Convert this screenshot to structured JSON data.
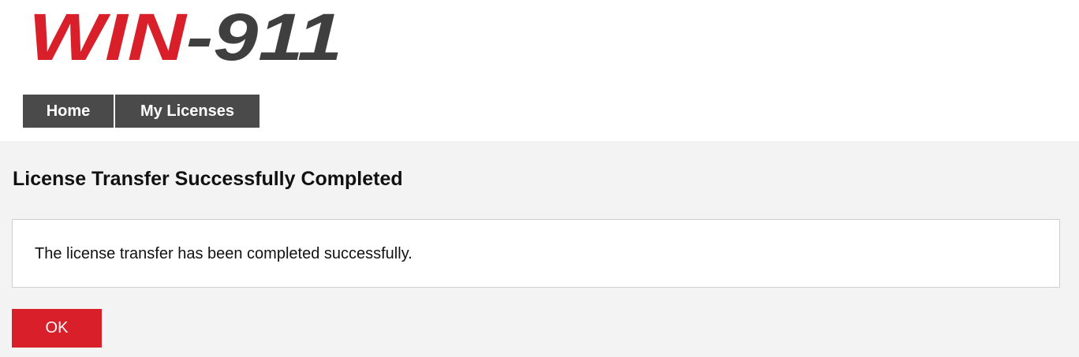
{
  "brand": {
    "logo_text_primary": "WIN",
    "logo_text_secondary": "-911",
    "primary_color": "#d9202a",
    "secondary_color": "#3f3f3f"
  },
  "nav": {
    "items": [
      {
        "label": "Home"
      },
      {
        "label": "My Licenses"
      }
    ],
    "background_color": "#4a4a4a"
  },
  "main": {
    "title": "License Transfer Successfully Completed",
    "message": "The license transfer has been completed successfully.",
    "ok_label": "OK",
    "background_color": "#f3f3f3"
  }
}
